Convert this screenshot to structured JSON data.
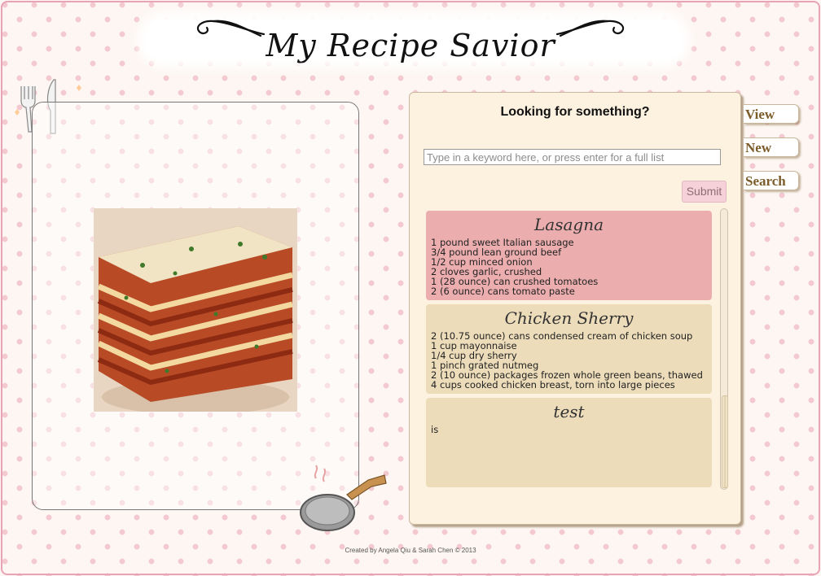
{
  "header": {
    "logo_text": "My Recipe Savior"
  },
  "search_panel": {
    "heading": "Looking for something?",
    "keyword_placeholder": "Type in a keyword here, or press enter for a full list",
    "keyword_value": "",
    "submit_label": "Submit"
  },
  "results": [
    {
      "title": "Lasagna",
      "color": "#ebadae",
      "lines": [
        "1 pound sweet Italian sausage",
        "3/4 pound lean ground beef",
        "1/2 cup minced onion",
        "2 cloves garlic, crushed",
        "1 (28 ounce) can crushed tomatoes",
        "2 (6 ounce) cans tomato paste"
      ]
    },
    {
      "title": "Chicken Sherry",
      "color": "#ecdcba",
      "lines": [
        "2 (10.75 ounce) cans condensed cream of chicken soup",
        "1 cup mayonnaise",
        "1/4 cup dry sherry",
        "1 pinch grated nutmeg",
        "2 (10 ounce) packages frozen whole green beans, thawed",
        "4 cups cooked chicken breast, torn into large pieces"
      ]
    },
    {
      "title": "test",
      "color": "#ecdcba",
      "lines": [
        "is"
      ]
    }
  ],
  "nav": {
    "view_label": "View",
    "new_label": "New",
    "search_label": "Search"
  },
  "footer": {
    "credit": "Created by Angela Qiu & Sarah Chen © 2013"
  },
  "icons": {
    "logo_swirls": "flourish-swirl-icon",
    "cutlery": "fork-knife-icon",
    "pan": "frying-pan-icon",
    "photo": "lasagna-photo"
  },
  "colors": {
    "accent_pink": "#e9a3b6",
    "panel_bg": "#fdf1e0",
    "nav_text": "#7b5c2a"
  }
}
